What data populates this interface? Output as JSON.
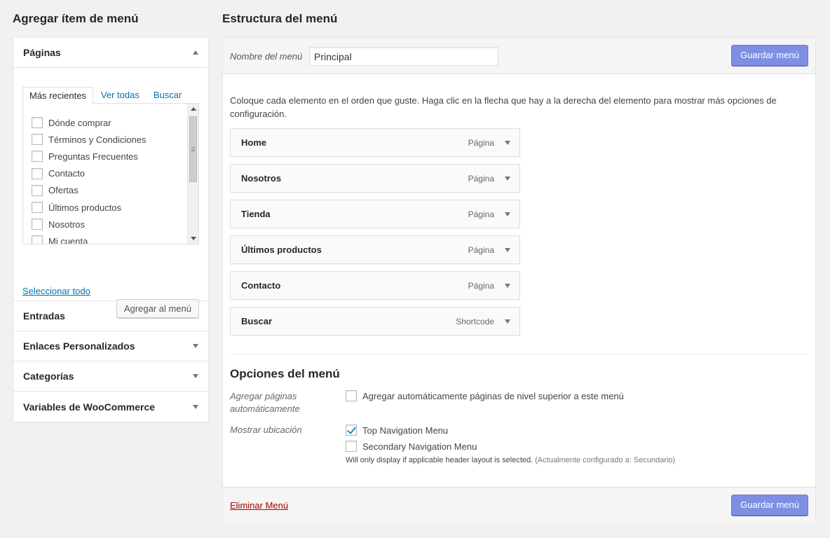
{
  "left": {
    "title": "Agregar ítem de menú",
    "pages_section": {
      "title": "Páginas",
      "tabs": [
        "Más recientes",
        "Ver todas",
        "Buscar"
      ],
      "items": [
        "Dónde comprar",
        "Términos y Condiciones",
        "Preguntas Frecuentes",
        "Contacto",
        "Ofertas",
        "Últimos productos",
        "Nosotros",
        "Mi cuenta"
      ],
      "select_all": "Seleccionar todo",
      "add_button": "Agregar al menú"
    },
    "sections": [
      "Entradas",
      "Enlaces Personalizados",
      "Categorías",
      "Variables de WooCommerce"
    ]
  },
  "right": {
    "title": "Estructura del menú",
    "name_label": "Nombre del menú",
    "name_value": "Principal",
    "save_button": "Guardar menú",
    "instructions": "Coloque cada elemento en el orden que guste. Haga clic en la flecha que hay a la derecha del elemento para mostrar más opciones de configuración.",
    "menu_items": [
      {
        "title": "Home",
        "type": "Página"
      },
      {
        "title": "Nosotros",
        "type": "Página"
      },
      {
        "title": "Tienda",
        "type": "Página"
      },
      {
        "title": "Últimos productos",
        "type": "Página"
      },
      {
        "title": "Contacto",
        "type": "Página"
      },
      {
        "title": "Buscar",
        "type": "Shortcode"
      }
    ],
    "options": {
      "title": "Opciones del menú",
      "auto_add_label": "Agregar páginas automáticamente",
      "auto_add_text": "Agregar automáticamente páginas de nivel superior a este menú",
      "location_label": "Mostrar ubicación",
      "locations": [
        {
          "label": "Top Navigation Menu",
          "checked": true
        },
        {
          "label": "Secondary Navigation Menu",
          "checked": false
        }
      ],
      "note": "Will only display if applicable header layout is selected.",
      "note_muted": "(Actualmente configurado a: Secundario)"
    },
    "delete_link": "Eliminar Menú"
  },
  "colors": {
    "primary_button": "#7e8fe3",
    "link": "#0073aa",
    "delete": "#aa0000",
    "check": "#1e8cbe"
  }
}
